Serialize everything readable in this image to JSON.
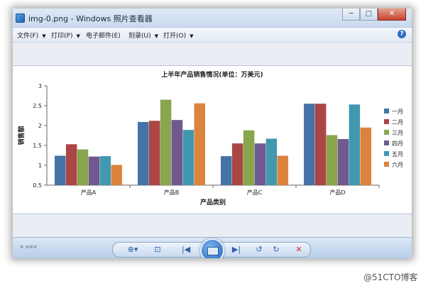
{
  "window": {
    "title": "img-0.png - Windows 照片查看器",
    "controls": {
      "minimize": "─",
      "maximize": "□",
      "close": "✕"
    }
  },
  "menu": {
    "file": "文件(F)",
    "print": "打印(P)",
    "email": "电子邮件(E)",
    "burn": "刻录(U)",
    "open": "打开(O)",
    "dropdown_arrow": "▼",
    "help": "?"
  },
  "toolbar": {
    "zoom": "⊕▾",
    "fit": "⊡",
    "previous": "|◀",
    "next": "▶|",
    "rotate_ccw": "↺",
    "rotate_cw": "↻",
    "delete": "✕"
  },
  "watermark": "@51CTO博客",
  "chart_data": {
    "type": "bar",
    "title": "上半年产品销售情况(单位：万美元)",
    "xlabel": "产品类别",
    "ylabel": "销售额",
    "categories": [
      "产品A",
      "产品B",
      "产品C",
      "产品D"
    ],
    "ylim": [
      0.5,
      3
    ],
    "yticks": [
      "0.5",
      "1",
      "1.5",
      "2",
      "2.5",
      "3"
    ],
    "grid": false,
    "legend_position": "right",
    "series": [
      {
        "name": "一月",
        "color": "#4572a7",
        "values": [
          1.24,
          2.09,
          1.23,
          2.55
        ]
      },
      {
        "name": "二月",
        "color": "#aa4643",
        "values": [
          1.53,
          2.12,
          1.55,
          2.55
        ]
      },
      {
        "name": "三月",
        "color": "#89a54e",
        "values": [
          1.4,
          2.65,
          1.88,
          1.76
        ]
      },
      {
        "name": "四月",
        "color": "#71588f",
        "values": [
          1.22,
          2.14,
          1.55,
          1.66
        ]
      },
      {
        "name": "五月",
        "color": "#4198af",
        "values": [
          1.23,
          1.89,
          1.67,
          2.53
        ]
      },
      {
        "name": "六月",
        "color": "#db843d",
        "values": [
          1.01,
          2.56,
          1.24,
          1.95
        ]
      }
    ]
  }
}
